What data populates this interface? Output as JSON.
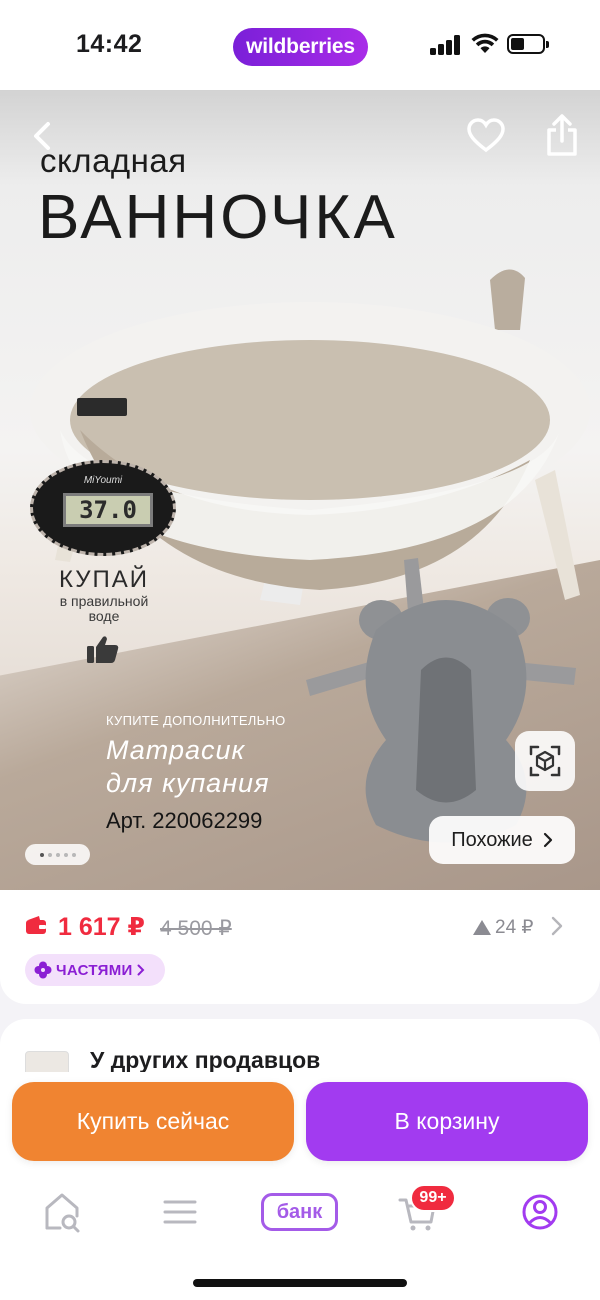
{
  "status_bar": {
    "time": "14:42",
    "brand": "wildberries"
  },
  "hero": {
    "title_small": "складная",
    "title_big": "ВАННОЧКА",
    "thermometer_brand": "MiYoumi",
    "thermometer_reading": "37.0",
    "bath_label_title": "КУПАЙ",
    "bath_label_sub_1": "в правильной",
    "bath_label_sub_2": "воде",
    "promo_small": "КУПИТЕ ДОПОЛНИТЕЛЬНО",
    "promo_line_1": "Матрасик",
    "promo_line_2": "для купания",
    "promo_article": "Арт. 220062299",
    "similar_label": "Похожие",
    "slide_count": 5,
    "active_slide": 1
  },
  "price": {
    "current": "1 617 ₽",
    "old": "4 500 ₽",
    "change": "24 ₽",
    "installments_label": "ЧАСТЯМИ"
  },
  "sellers": {
    "title": "У других продавцов"
  },
  "actions": {
    "buy_now": "Купить сейчас",
    "add_to_cart": "В корзину"
  },
  "tabbar": {
    "bank_label": "банк",
    "cart_badge": "99+"
  },
  "colors": {
    "accent_purple": "#a23bf0",
    "buy_orange": "#f08431",
    "price_red": "#f02b3f"
  }
}
